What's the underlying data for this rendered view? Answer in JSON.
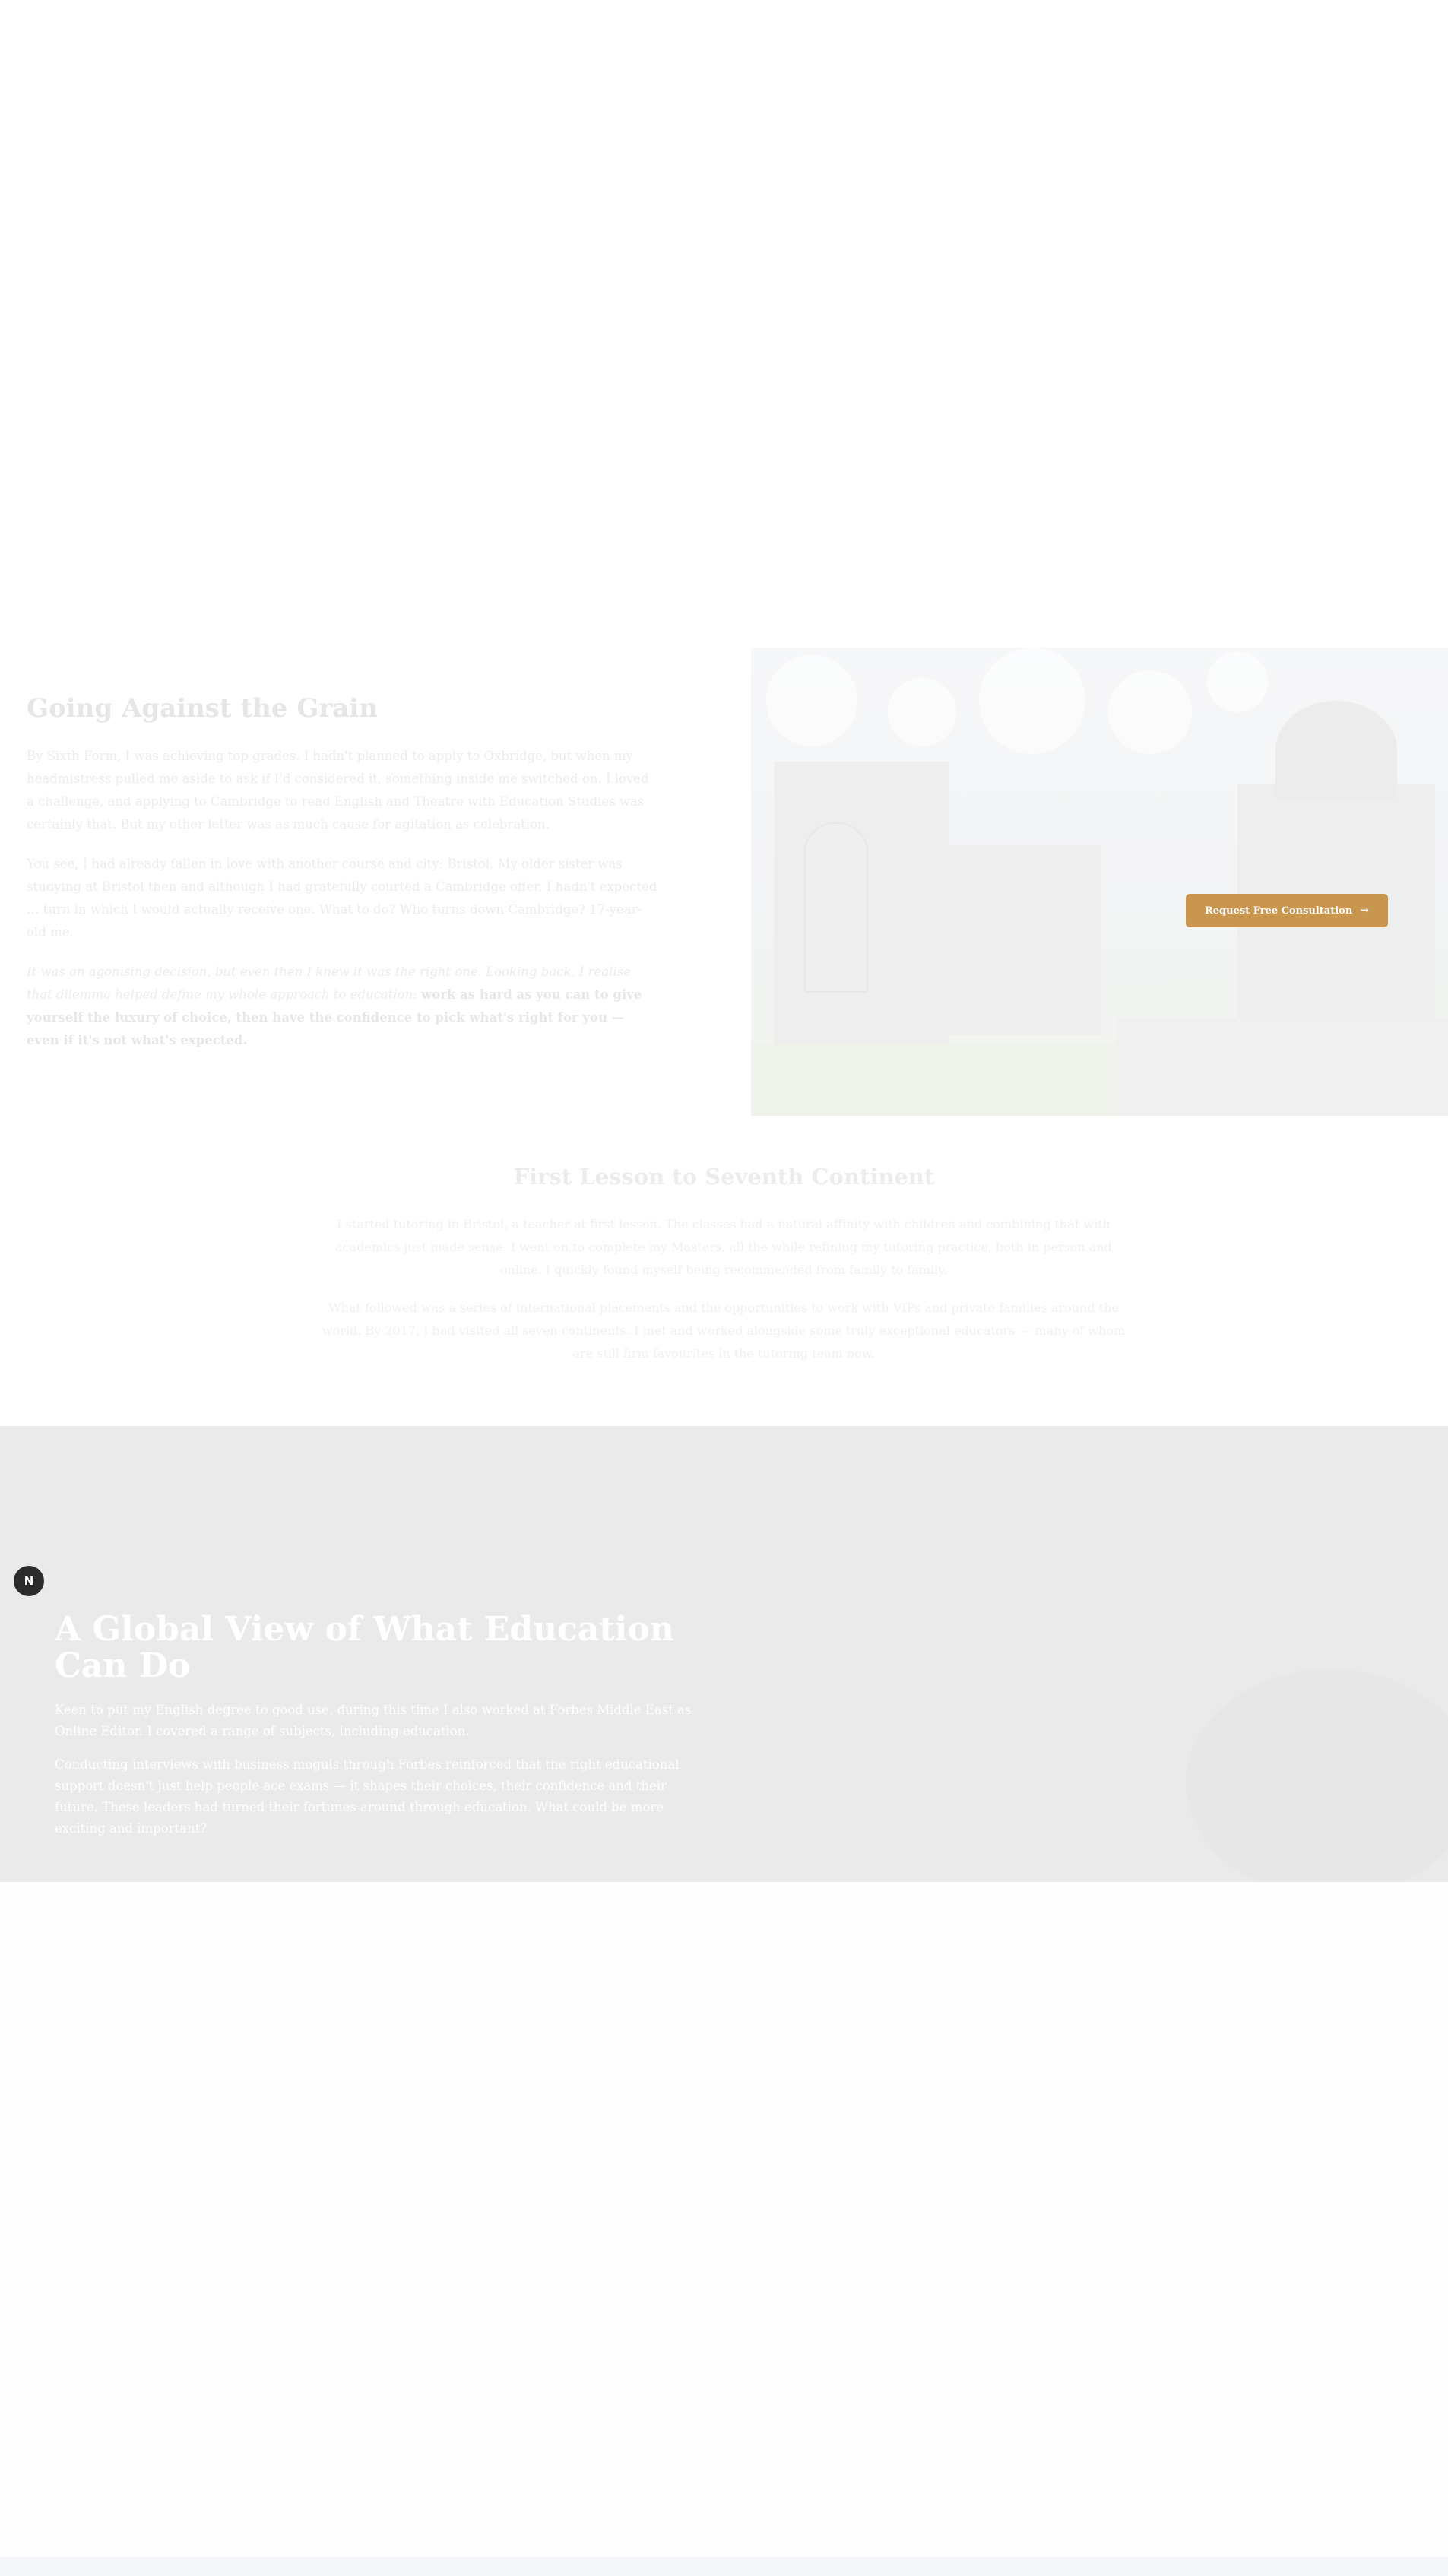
{
  "grain": {
    "title": "Going Against the Grain",
    "p1": "By Sixth Form, I was achieving top grades. I hadn't planned to apply to Oxbridge, but when my headmistress pulled me aside to ask if I'd considered it, something inside me switched on. I loved a challenge, and applying to Cambridge to read English and Theatre with Education Studies was certainly that. But my other letter was as much cause for agitation as celebration.",
    "p2": "You see, I had already fallen in love with another course and city: Bristol. My older sister was studying at Bristol then and although I had gratefully courted a Cambridge offer, I hadn't expected … turn in which I would actually receive one. What to do? Who turns down Cambridge? 17-year-old me.",
    "p3_plain": "It was an agonising decision, but even then I knew it was the right one. Looking back, I realise that dilemma helped define my whole approach to education:",
    "p3_bold": "work as hard as you can to give yourself the luxury of choice, then have the confidence to pick what's right for you — even if it's not what's expected.",
    "button_label": "Request Free Consultation",
    "button_icon": "arrow-right"
  },
  "lesson": {
    "title": "First Lesson to Seventh Continent",
    "p1": "I started tutoring in Bristol, a teacher at first lesson. The classes had a natural affinity with children and combining that with academics just made sense. I went on to complete my Masters, all the while refining my tutoring practice, both in person and online. I quickly found myself being recommended from family to family.",
    "p2": "What followed was a series of international placements and the opportunities to work with VIPs and private families around the world. By 2017, I had visited all seven continents. I met and worked alongside some truly exceptional educators — many of whom are still firm favourites in the tutoring team now."
  },
  "global": {
    "title": "A Global View of What Education Can Do",
    "p1": "Keen to put my English degree to good use, during this time I also worked at Forbes Middle East as Online Editor. I covered a range of subjects, including education.",
    "p2": "Conducting interviews with business moguls through Forbes reinforced that the right educational support doesn't just help people ace exams — it shapes their choices, their confidence and their future. These leaders had turned their fortunes around through education. What could be more exciting and important?",
    "chat_icon_letter": "N"
  },
  "colors": {
    "accent": "#c8964f",
    "global_bg": "#eaeaea",
    "chat_bg": "#2b2b2b"
  }
}
